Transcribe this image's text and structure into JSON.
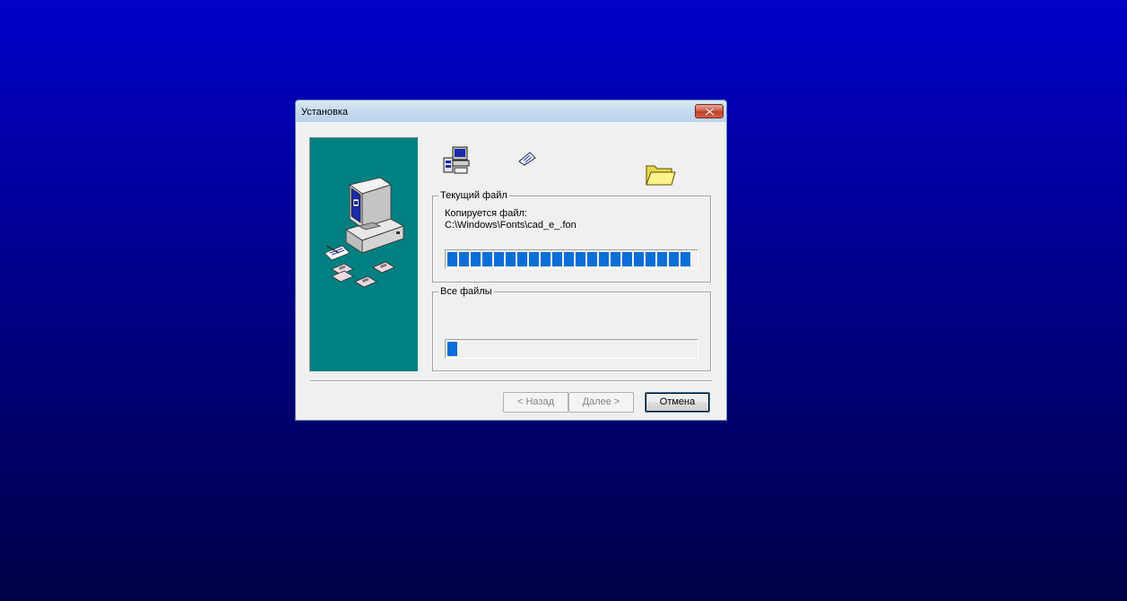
{
  "window": {
    "title": "Установка"
  },
  "current_file": {
    "legend": "Текущий файл",
    "status_label": "Копируется файл:",
    "file_path": "C:\\Windows\\Fonts\\cad_e_.fon",
    "progress": 1.0
  },
  "all_files": {
    "legend": "Все файлы",
    "progress": 0.04
  },
  "buttons": {
    "back": "< Назад",
    "next": "Далее >",
    "cancel": "Отмена"
  },
  "colors": {
    "desktop_top": "#0000c8",
    "desktop_bottom": "#000046",
    "side_panel": "#008080",
    "progress_fill": "#0a6fd7"
  },
  "icons": {
    "source": "computer-setup-icon",
    "flying_document": "flying-document-icon",
    "destination": "folder-icon",
    "illustration": "computer-with-floppies-icon",
    "close": "close-icon"
  }
}
